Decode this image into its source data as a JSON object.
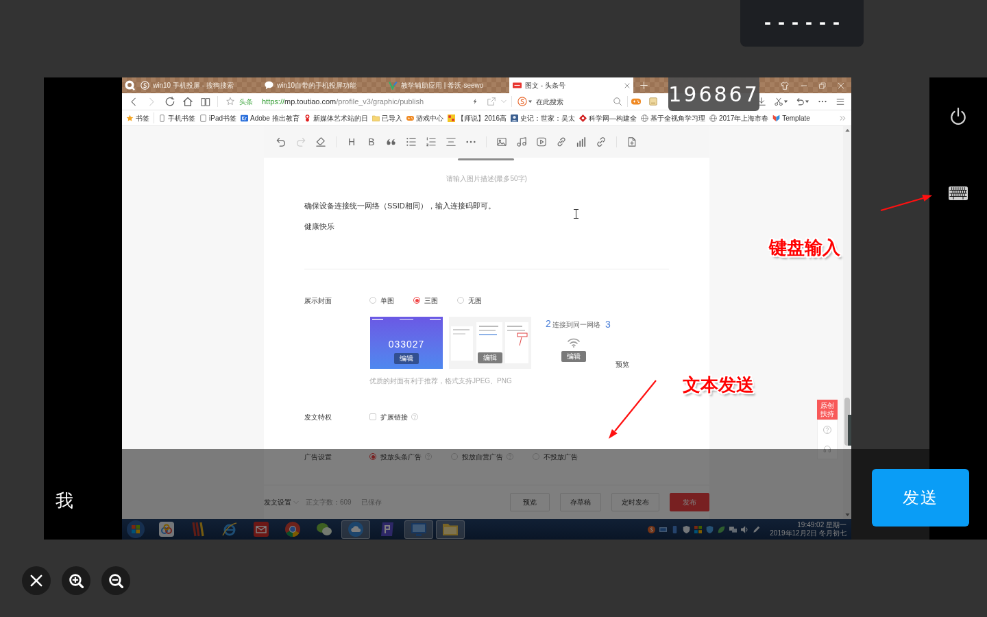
{
  "code_panel": {
    "text": "------"
  },
  "remote_screen": {
    "connection_code": "196867",
    "browser": {
      "tabs": [
        {
          "title": "win10 手机投屏 - 搜狗搜索",
          "selected": false
        },
        {
          "title": "win10自带的手机投屏功能",
          "selected": false
        },
        {
          "title": "教学辅助应用 | 希沃-seewo",
          "selected": false
        },
        {
          "title": "图文 - 头条号",
          "selected": true
        }
      ],
      "address_bar": {
        "site_label": "头条",
        "url_scheme": "https://",
        "url_host": "mp.toutiao.com",
        "url_path": "/profile_v3/graphic/publish"
      },
      "search_field": {
        "placeholder": "在此搜索"
      },
      "bookmarks": [
        "书签",
        "手机书签",
        "iPad书签",
        "Adobe 推出教育",
        "新媒体艺术站的日",
        "已导入",
        "游戏中心",
        "【师说】2016高",
        "史记：世家：吴太",
        "科学网—构建全",
        "基于全视角学习理",
        "2017年上海市春",
        "Template"
      ]
    },
    "editor": {
      "toolbar_labels": [
        "H",
        "B"
      ],
      "image_caption": {
        "placeholder": "请输入图片描述(最多50字)"
      },
      "paragraphs": [
        "确保设备连接统一网络（SSID相同），输入连接码即可。",
        "健康快乐"
      ],
      "cover": {
        "label": "展示封面",
        "options": [
          {
            "label": "单图",
            "selected": false
          },
          {
            "label": "三图",
            "selected": true
          },
          {
            "label": "无图",
            "selected": false
          }
        ],
        "thumbnails": [
          {
            "kind": "code",
            "code": "033027",
            "button": "编辑"
          },
          {
            "kind": "screenshot",
            "button": "编辑"
          },
          {
            "kind": "steps",
            "step": "2",
            "title": "连接到同一网络",
            "button": "编辑"
          }
        ],
        "next_step": "3",
        "preview": "预览",
        "hint": "优质的封面有利于推荐，格式支持JPEG、PNG"
      },
      "privilege": {
        "label": "发文特权",
        "option": "扩展链接",
        "checked": false,
        "help": true
      },
      "ads": {
        "label": "广告设置",
        "options": [
          {
            "label": "投放头条广告",
            "selected": true,
            "help": true
          },
          {
            "label": "投放自营广告",
            "selected": false,
            "help": true
          },
          {
            "label": "不投放广告",
            "selected": false,
            "help": false
          }
        ]
      },
      "footer": {
        "settings": "发文设置",
        "word_count": "正文字数：609",
        "save_state": "已保存",
        "buttons": [
          {
            "label": "预览",
            "kind": "plain"
          },
          {
            "label": "存草稿",
            "kind": "plain"
          },
          {
            "label": "定时发布",
            "kind": "plain"
          },
          {
            "label": "发布",
            "kind": "primary"
          }
        ]
      },
      "side_widget": {
        "badge": "原创扶持"
      }
    },
    "taskbar": {
      "apps": [
        {
          "open": false
        },
        {
          "open": false
        },
        {
          "open": false
        },
        {
          "open": false
        },
        {
          "open": false
        },
        {
          "open": false
        },
        {
          "open": true
        },
        {
          "open": false
        },
        {
          "open": true
        },
        {
          "open": true
        }
      ],
      "clock_time": "19:49:02 星期一",
      "clock_date": "2019年12月2日 冬月初七"
    }
  },
  "message_input": {
    "value": "我"
  },
  "send_button": {
    "label": "发送"
  },
  "annotations": [
    {
      "text": "键盘输入"
    },
    {
      "text": "文本发送"
    }
  ]
}
